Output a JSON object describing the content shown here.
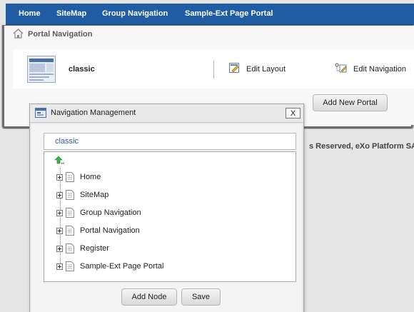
{
  "topnav": {
    "items": [
      {
        "label": "Home"
      },
      {
        "label": "SiteMap"
      },
      {
        "label": "Group Navigation"
      },
      {
        "label": "Sample-Ext Page Portal"
      }
    ]
  },
  "breadcrumb": {
    "label": "Portal Navigation"
  },
  "portal": {
    "name": "classic",
    "edit_layout": "Edit Layout",
    "edit_navigation": "Edit Navigation"
  },
  "add_portal_button": "Add New Portal",
  "footer_text": "s Reserved, eXo Platform SA",
  "dialog": {
    "title": "Navigation Management",
    "close_label": "X",
    "selected_portal": "classic",
    "tree": [
      {
        "label": "Home"
      },
      {
        "label": "SiteMap"
      },
      {
        "label": "Group Navigation"
      },
      {
        "label": "Portal Navigation"
      },
      {
        "label": "Register"
      },
      {
        "label": "Sample-Ext Page Portal"
      }
    ],
    "add_node_button": "Add Node",
    "save_button": "Save"
  },
  "icons": {
    "breadcrumb": "home-icon",
    "edit_layout": "edit-layout-icon",
    "edit_navigation": "edit-navigation-icon",
    "dialog": "window-icon",
    "tree_up": "level-up-icon",
    "tree_page": "page-icon"
  },
  "colors": {
    "topbar": "#1f5ca4",
    "selected_text": "#2a5fa0"
  }
}
